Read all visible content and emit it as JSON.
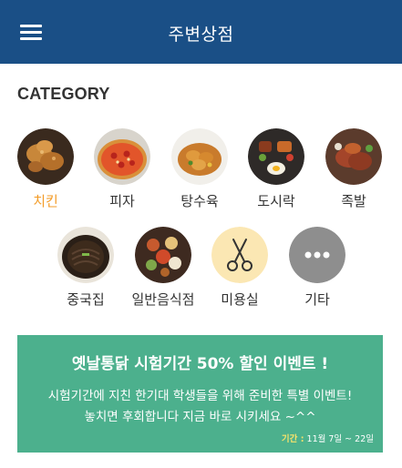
{
  "header": {
    "title": "주변상점"
  },
  "section": {
    "title": "CATEGORY"
  },
  "categories": [
    {
      "label": "치킨",
      "icon": "fried-chicken-photo",
      "active": true
    },
    {
      "label": "피자",
      "icon": "pizza-photo"
    },
    {
      "label": "탕수육",
      "icon": "sweet-sour-pork-photo"
    },
    {
      "label": "도시락",
      "icon": "lunchbox-photo"
    },
    {
      "label": "족발",
      "icon": "pork-feet-photo"
    },
    {
      "label": "중국집",
      "icon": "jajangmyeon-photo"
    },
    {
      "label": "일반음식점",
      "icon": "korean-table-photo"
    },
    {
      "label": "미용실",
      "icon": "scissors-icon"
    },
    {
      "label": "기타",
      "icon": "more-icon"
    }
  ],
  "promo": {
    "title": "옛날통닭 시험기간 50% 할인 이벤트 !",
    "line1": "시험기간에 지친 한기대 학생들을 위해 준비한 특별 이벤트!",
    "line2": "놓치면 후회합니다 지금 바로 시키세요 ~^^",
    "period_label": "기간 :",
    "period_value": "11월 7일 ~ 22일"
  },
  "colors": {
    "appbar": "#1a4f86",
    "active_label": "#f39c28",
    "promo_bg": "#4cb08d",
    "promo_period_label": "#f7e36a"
  }
}
